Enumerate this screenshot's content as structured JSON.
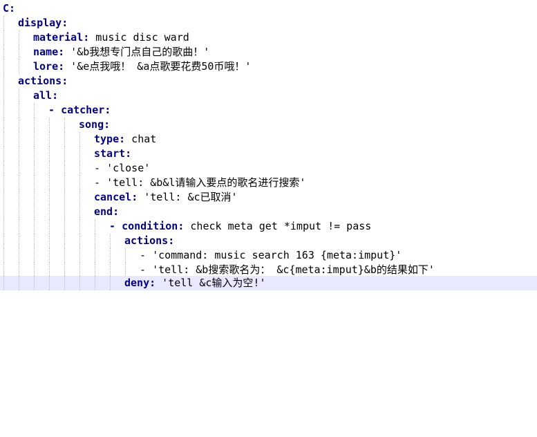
{
  "editor": {
    "lines": [
      {
        "key": "C",
        "colon": ":"
      },
      {
        "key": "display",
        "colon": ":"
      },
      {
        "key": "material",
        "colon": ":",
        "value": " music disc ward"
      },
      {
        "key": "name",
        "colon": ":",
        "value": " '&b我想专门点自己的歌曲！'"
      },
      {
        "key": "lore",
        "colon": ":",
        "value": " '&e点我哦！ &a点歌要花费50币哦！'"
      },
      {
        "key": "actions",
        "colon": ":"
      },
      {
        "key": "all",
        "colon": ":"
      },
      {
        "dash": "- ",
        "key": "catcher",
        "colon": ":"
      },
      {
        "key": "song",
        "colon": ":"
      },
      {
        "key": "type",
        "colon": ":",
        "value": " chat"
      },
      {
        "key": "start",
        "colon": ":"
      },
      {
        "dash": "- ",
        "value": "'close'"
      },
      {
        "dash": "- ",
        "value": "'tell: &b&l请输入要点的歌名进行搜索'"
      },
      {
        "key": "cancel",
        "colon": ":",
        "value": " 'tell: &c已取消'"
      },
      {
        "key": "end",
        "colon": ":"
      },
      {
        "dash": "- ",
        "key": "condition",
        "colon": ":",
        "value": " check meta get *imput != pass"
      },
      {
        "key": "actions",
        "colon": ":"
      },
      {
        "dash": "- ",
        "value": "'command: music search 163 {meta:imput}'"
      },
      {
        "dash": "- ",
        "value": "'tell: &b搜索歌名为： &c{meta:imput}&b的结果如下'"
      },
      {
        "key": "deny",
        "colon": ":",
        "value": " 'tell &c输入为空!'"
      }
    ]
  },
  "colors": {
    "key": "#000080",
    "text": "#000000",
    "current_line": "#e8e8ff",
    "indent_guide": "#b8b8b8"
  }
}
